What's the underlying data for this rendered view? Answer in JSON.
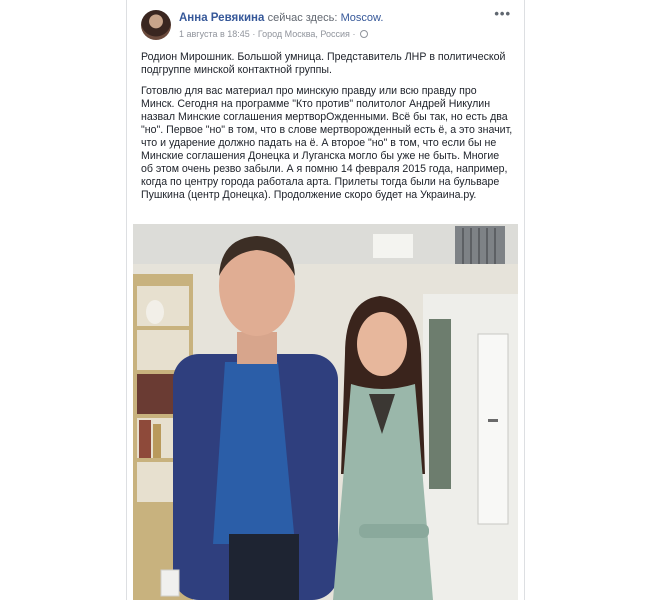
{
  "post": {
    "author": "Анна Ревякина",
    "status": "сейчас здесь:",
    "location": "Moscow.",
    "date": "1 августа в 18:45",
    "separator": "·",
    "place": "Город Москва, Россия",
    "more_label": "•••",
    "paragraphs": [
      "Родион Мирошник. Большой умница. Представитель ЛНР в политической подгруппе минской контактной группы.",
      "Готовлю для вас материал про минскую правду или всю правду про Минск. Сегодня на программе \"Кто против\" политолог Андрей Никулин назвал Минские соглашения мертворОжденными. Всё бы так, но есть два \"но\". Первое \"но\" в том, что в слове мертворожденный есть ё, а это значит, что и ударение должно падать на ё. А второе \"но\" в том, что если бы не Минские соглашения Донецка и Луганска могло бы уже не быть. Многие об этом очень резво забыли. А я помню 14 февраля 2015 года, например, когда по центру города работала арта. Прилеты тогда были на бульваре Пушкина (центр Донецка). Продолжение скоро будет на Украина.ру."
    ]
  },
  "colors": {
    "link": "#365899",
    "text": "#1d2129",
    "meta": "#90949c"
  },
  "icons": [
    "globe-icon",
    "more-options-icon"
  ]
}
